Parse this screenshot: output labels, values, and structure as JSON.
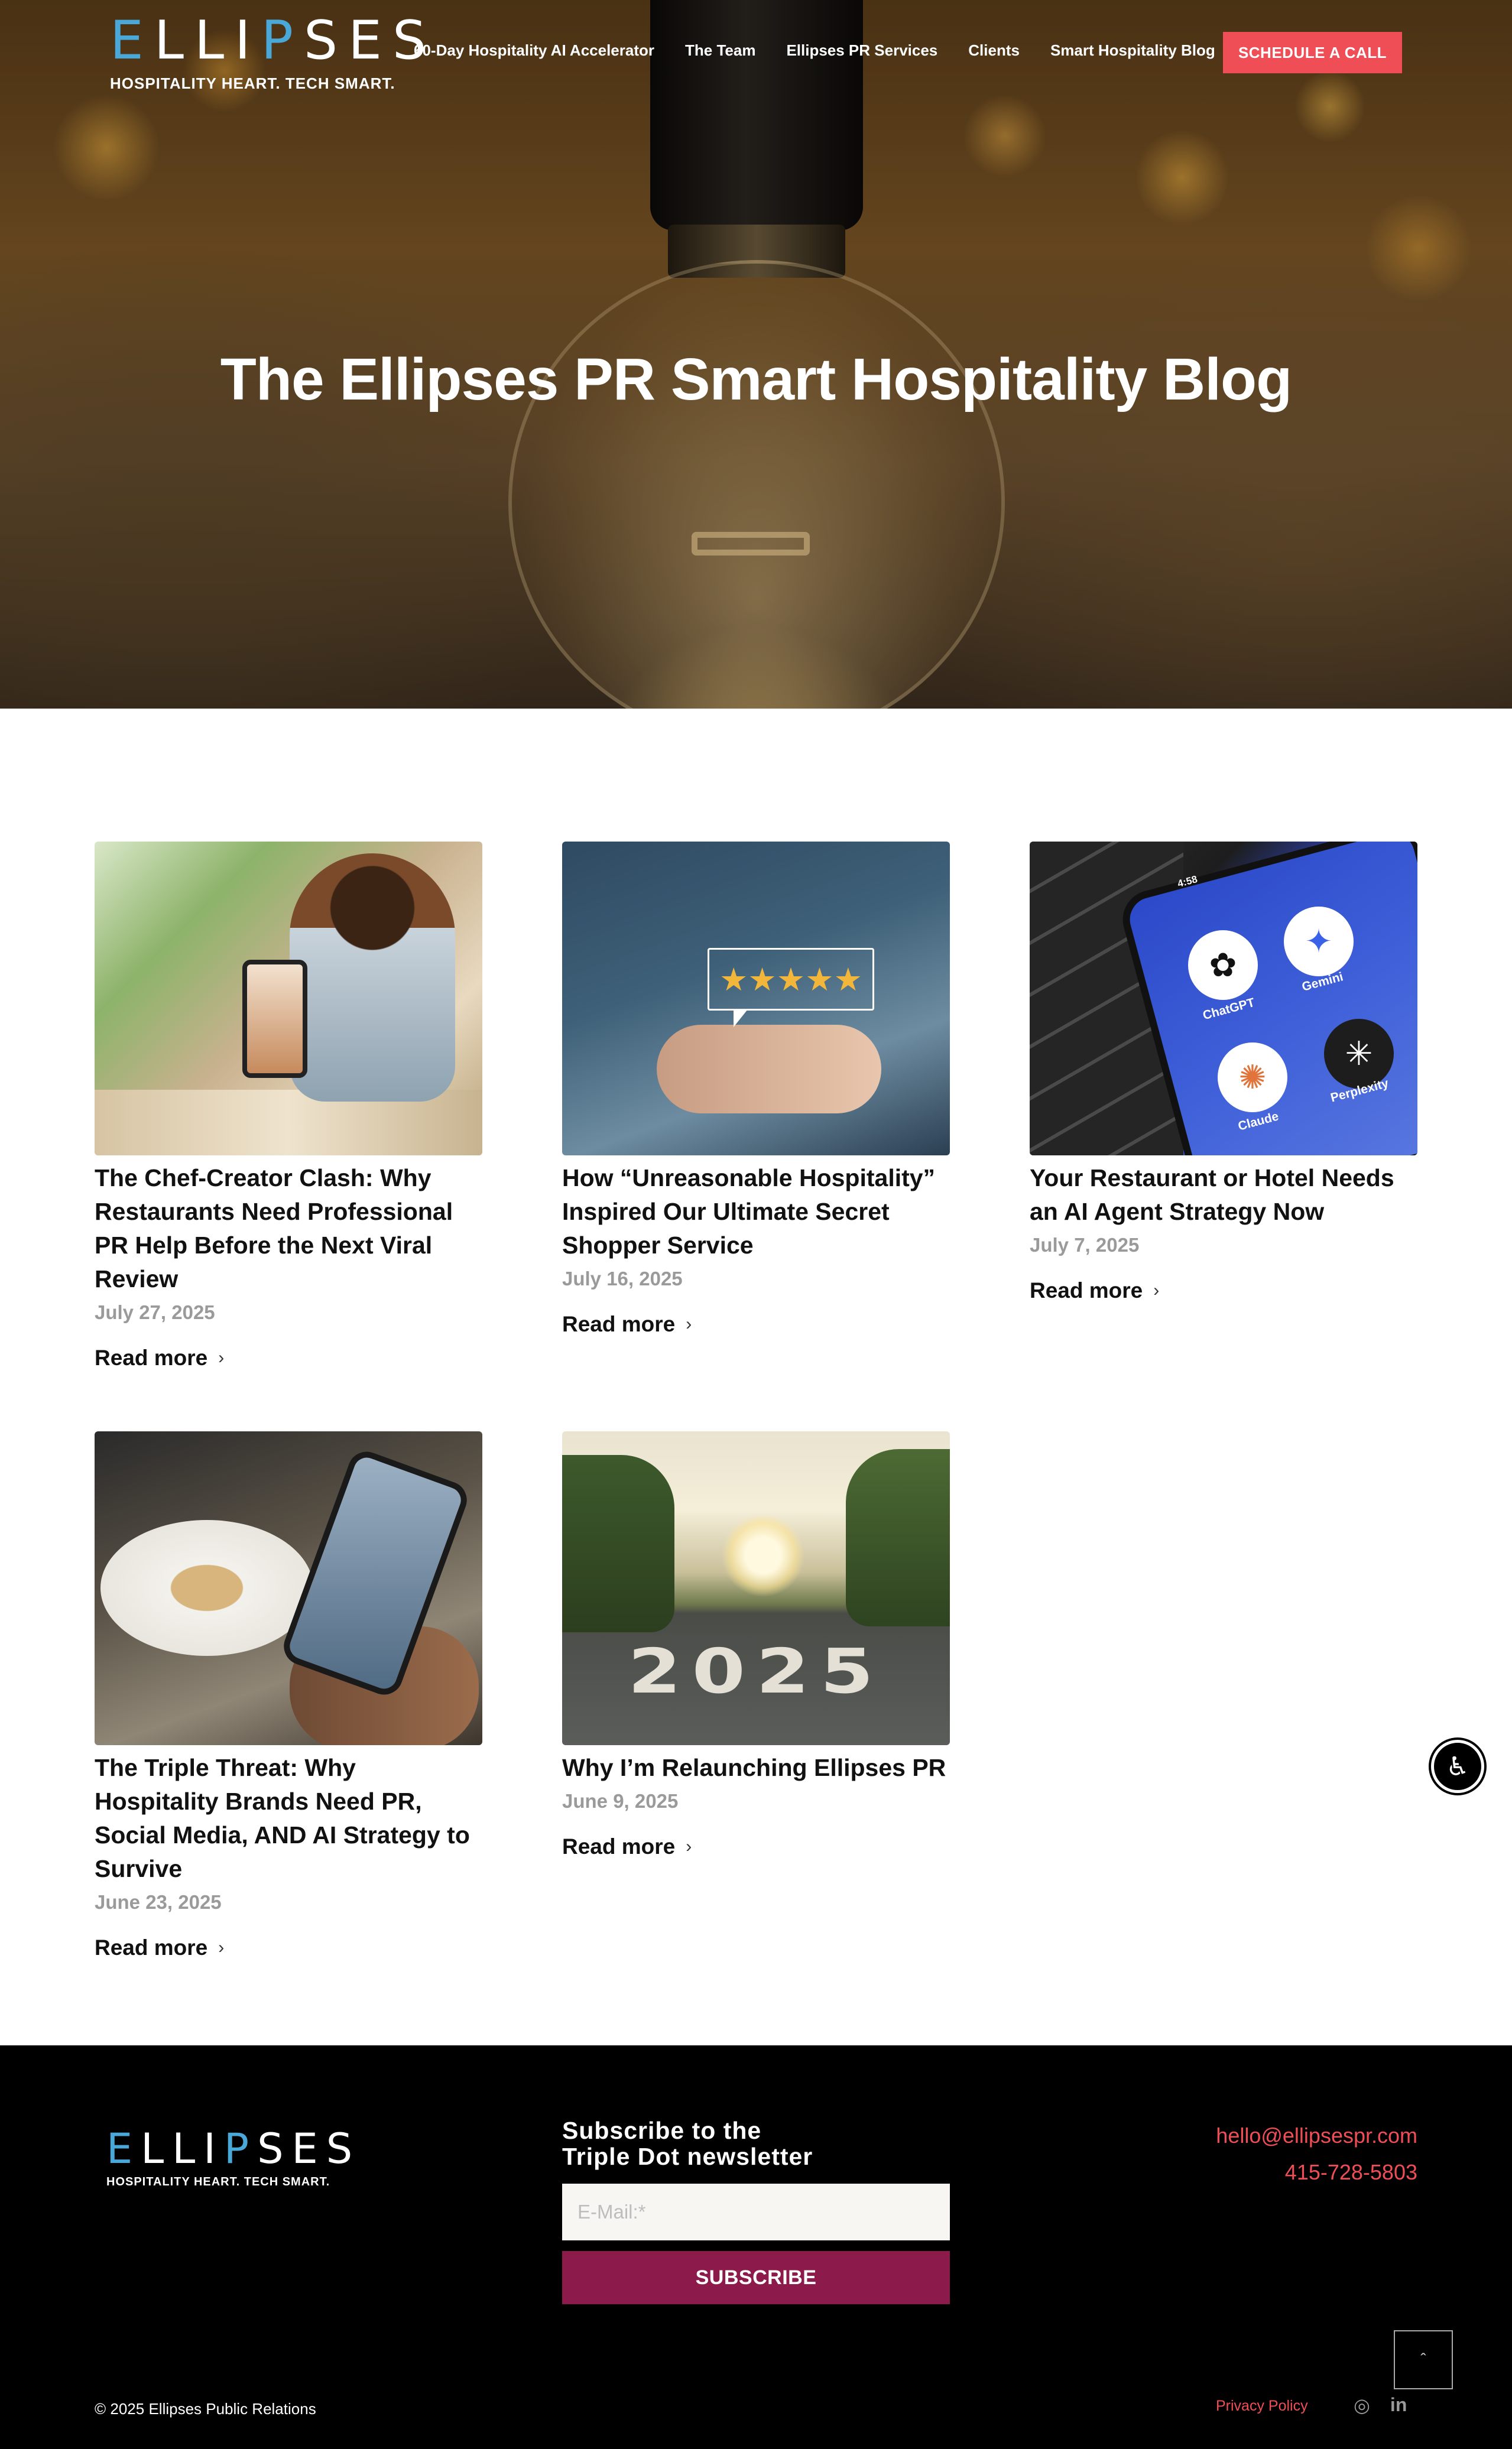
{
  "brand": {
    "logo_text": "ELLIPSES",
    "tagline": "HOSPITALITY HEART. TECH SMART."
  },
  "nav": {
    "items": [
      "60-Day Hospitality AI Accelerator",
      "The Team",
      "Ellipses PR Services",
      "Clients",
      "Smart Hospitality Blog"
    ],
    "cta": "SCHEDULE A CALL"
  },
  "hero": {
    "title": "The Ellipses PR Smart Hospitality Blog"
  },
  "posts": [
    {
      "title": "The Chef-Creator Clash: Why Restaurants Need Professional PR Help Before the Next Viral Review",
      "date": "July 27, 2025",
      "read_more": "Read more"
    },
    {
      "title": "How “Unreasonable Hospitality” Inspired Our Ultimate Secret Shopper Service",
      "date": "July 16, 2025",
      "read_more": "Read more"
    },
    {
      "title": "Your Restaurant or Hotel Needs an AI Agent Strategy Now",
      "date": "July 7, 2025",
      "read_more": "Read more",
      "image_labels": [
        "4:58",
        "ChatGPT",
        "Gemini",
        "Claude",
        "Perplexity"
      ]
    },
    {
      "title": "The Triple Threat: Why Hospitality Brands Need PR, Social Media, AND AI Strategy to Survive",
      "date": "June 23, 2025",
      "read_more": "Read more"
    },
    {
      "title": "Why I’m Relaunching Ellipses PR",
      "date": "June 9, 2025",
      "read_more": "Read more",
      "image_text": "2025"
    }
  ],
  "footer": {
    "newsletter_title_line1": "Subscribe to the",
    "newsletter_title_line2": "Triple Dot newsletter",
    "email_placeholder": "E-Mail:*",
    "subscribe_label": "SUBSCRIBE",
    "email": "hello@ellipsespr.com",
    "phone": "415-728-5803",
    "copyright": "© 2025 Ellipses Public Relations",
    "privacy": "Privacy Policy",
    "social": [
      "instagram-icon",
      "linkedin-icon"
    ]
  },
  "colors": {
    "accent": "#ef4e57",
    "subscribe": "#8c1a4a",
    "logo_accent": "#4aa8d8"
  }
}
